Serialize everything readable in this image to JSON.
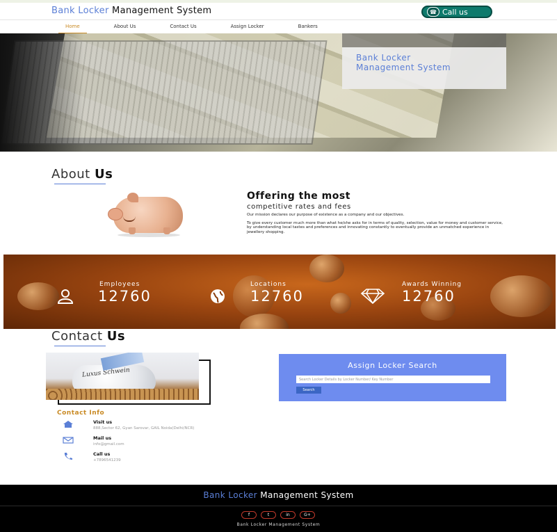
{
  "header": {
    "brand_part1": "Bank Locker",
    "brand_part2": "Management System",
    "call_label": "Call us"
  },
  "nav": {
    "items": [
      {
        "label": "Home",
        "active": true
      },
      {
        "label": "About Us"
      },
      {
        "label": "Contact Us"
      },
      {
        "label": "Assign Locker"
      },
      {
        "label": "Bankers"
      }
    ]
  },
  "hero": {
    "title_line1": "Bank Locker",
    "title_line2": "Management System"
  },
  "about": {
    "title_part1": "About",
    "title_part2": "Us",
    "heading": "Offering the most",
    "subheading": "competitive rates and fees",
    "para1": "Our mission declares our purpose of existence as a company and our objectives.",
    "para2": "To give every customer much more than what he/she asks for in terms of quality, selection, value for money and customer service, by understanding local tastes and preferences and innovating constantly to eventually provide an unmatched experience in jewellery shopping."
  },
  "stats": [
    {
      "label": "Employees",
      "value": "12760",
      "icon": "user-icon"
    },
    {
      "label": "Locations",
      "value": "12760",
      "icon": "globe-icon"
    },
    {
      "label": "Awards Winning",
      "value": "12760",
      "icon": "diamond-icon"
    }
  ],
  "contact": {
    "title_part1": "Contact",
    "title_part2": "Us",
    "info_title": "Contact Info",
    "image_text": "Luxus Schwein",
    "rows": [
      {
        "heading": "Visit us",
        "value": "888,Sector 62, Gyan Sarovar, GAIL Noida(Delhi/NCR)",
        "icon": "home-icon"
      },
      {
        "heading": "Mail us",
        "value": "info@gmail.com",
        "icon": "mail-icon"
      },
      {
        "heading": "Call us",
        "value": "+7896541239",
        "icon": "phone-icon"
      }
    ]
  },
  "assign": {
    "title": "Assign Locker Search",
    "placeholder": "Search Locker Details by Locker Number/ Key Number",
    "button": "Search"
  },
  "footer": {
    "brand_part1": "Bank Locker",
    "brand_part2": "Management System",
    "socials": [
      "f",
      "t",
      "in",
      "G+"
    ],
    "copyright": "Bank Locker Management System"
  },
  "colors": {
    "accent_blue": "#5b7fd6",
    "accent_gold": "#c98a24",
    "assign_bg": "#6e8cef",
    "call_green": "#0e7a6c"
  }
}
